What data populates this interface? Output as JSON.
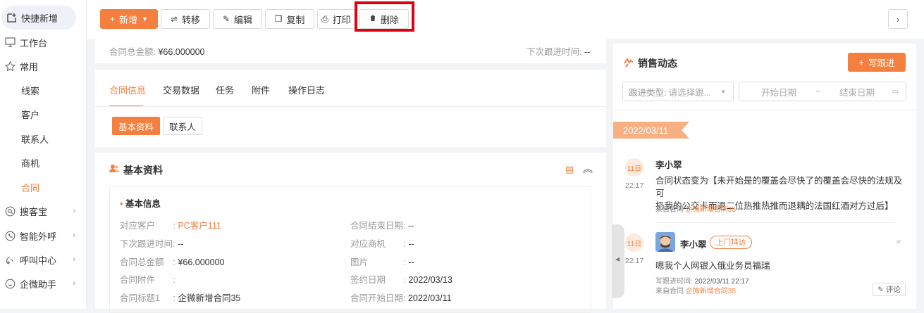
{
  "sidebar": {
    "quick_add": "快捷新增",
    "workbench": "工作台",
    "common": "常用",
    "sub_items": [
      "线索",
      "客户",
      "联系人",
      "商机",
      "合同"
    ],
    "souke": "搜客宝",
    "smart_call": "智能外呼",
    "call_center": "呼叫中心",
    "wecom_assistant": "企微助手"
  },
  "toolbar": {
    "new_label": "新增",
    "transfer_label": "转移",
    "edit_label": "编辑",
    "copy_label": "复制",
    "print_label": "打印",
    "delete_label": "删除"
  },
  "summary": {
    "amount_label": "合同总金额:",
    "amount_value": "¥66.000000",
    "next_follow_label": "下次跟进时间:",
    "next_follow_value": "--"
  },
  "tabs": [
    "合同信息",
    "交易数据",
    "任务",
    "附件",
    "操作日志"
  ],
  "subtabs": [
    "基本资料",
    "联系人"
  ],
  "basic": {
    "section_title": "基本资料",
    "group_title": "基本信息",
    "fields_left": [
      {
        "label": "对应客户",
        "value": "PC客户111"
      },
      {
        "label": "下次跟进时间:",
        "value": "--"
      },
      {
        "label": "合同总金额",
        "value": "¥66.000000"
      },
      {
        "label": "合同附件",
        "value": ""
      },
      {
        "label": "合同标题1",
        "value": "企微新增合同35"
      }
    ],
    "fields_right": [
      {
        "label": "合同结束日期:",
        "value": "--"
      },
      {
        "label": "对应商机",
        "value": "--"
      },
      {
        "label": "图片",
        "value": "--"
      },
      {
        "label": "签约日期",
        "value": "2022/03/13"
      },
      {
        "label": "合同开始日期:",
        "value": "2022/03/11"
      }
    ]
  },
  "dynamics": {
    "title": "销售动态",
    "write_follow": "写跟进",
    "type_label": "跟进类型:",
    "type_placeholder": "请选择跟...",
    "start_date": "开始日期",
    "tilde": "~",
    "end_date": "结束日期",
    "date_ribbon": "2022/03/11",
    "entries": [
      {
        "day": "11日",
        "time": "22:17",
        "name": "李小翠",
        "text": "合同状态变为【未开始是的覆盖会尽快了的覆盖会尽快的法规及可扔我的公交卡而退二位热推热推而退耦的法国红酒对方过后】",
        "text_line1": "合同状态变为【未开始是的覆盖会尽快了的覆盖会尽快的法规及可",
        "text_line2": "扔我的公交卡而退二位热推热推而退耦的法国红酒对方过后】",
        "from_label": "来自合同",
        "from_value": "企微新增合同35"
      },
      {
        "day": "11日",
        "time": "22:17",
        "name": "李小翠",
        "badge": "上门拜访",
        "text": "嗯我个人网银入俄业务员福瑞",
        "write_time_label": "写跟进时间:",
        "write_time_value": "2022/03/11 22:17",
        "from_label": "来自合同",
        "from_value": "企微新增合同35",
        "comment": "评论"
      }
    ]
  },
  "colors": {
    "accent": "#f47f3e",
    "highlight": "#e0000f"
  }
}
